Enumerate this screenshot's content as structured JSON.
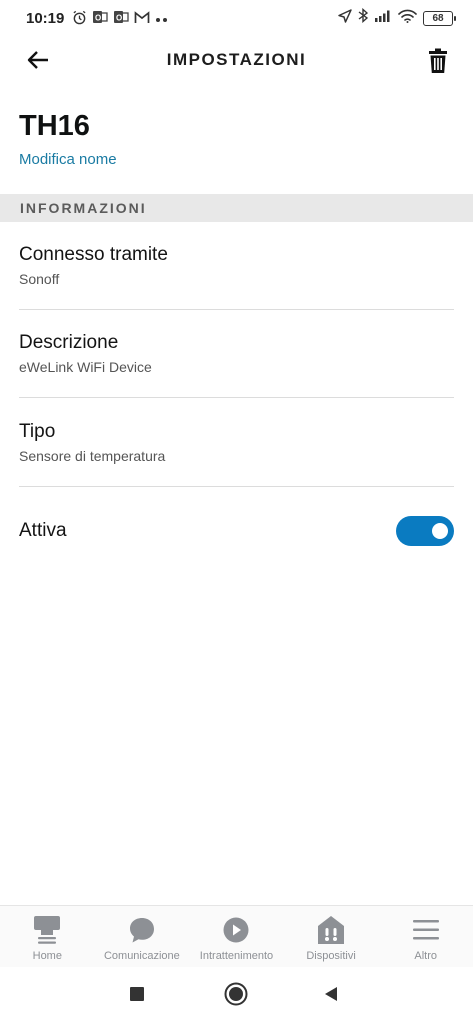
{
  "status_bar": {
    "time": "10:19",
    "battery": "68"
  },
  "header": {
    "title": "IMPOSTAZIONI"
  },
  "device": {
    "name": "TH16",
    "edit_label": "Modifica nome"
  },
  "section": {
    "title": "INFORMAZIONI"
  },
  "info": [
    {
      "label": "Connesso tramite",
      "value": "Sonoff"
    },
    {
      "label": "Descrizione",
      "value": "eWeLink WiFi Device"
    },
    {
      "label": "Tipo",
      "value": "Sensore di temperatura"
    }
  ],
  "toggle": {
    "label": "Attiva",
    "enabled": true,
    "color": "#0a7bc1"
  },
  "bottom_nav": [
    {
      "label": "Home",
      "icon": "home-icon"
    },
    {
      "label": "Comunicazione",
      "icon": "chat-bubble-icon"
    },
    {
      "label": "Intrattenimento",
      "icon": "play-icon"
    },
    {
      "label": "Dispositivi",
      "icon": "devices-icon"
    },
    {
      "label": "Altro",
      "icon": "menu-icon"
    }
  ],
  "colors": {
    "accent": "#0a7bc1",
    "link": "#1a7ba3",
    "section_bg": "#e8e8e8"
  }
}
